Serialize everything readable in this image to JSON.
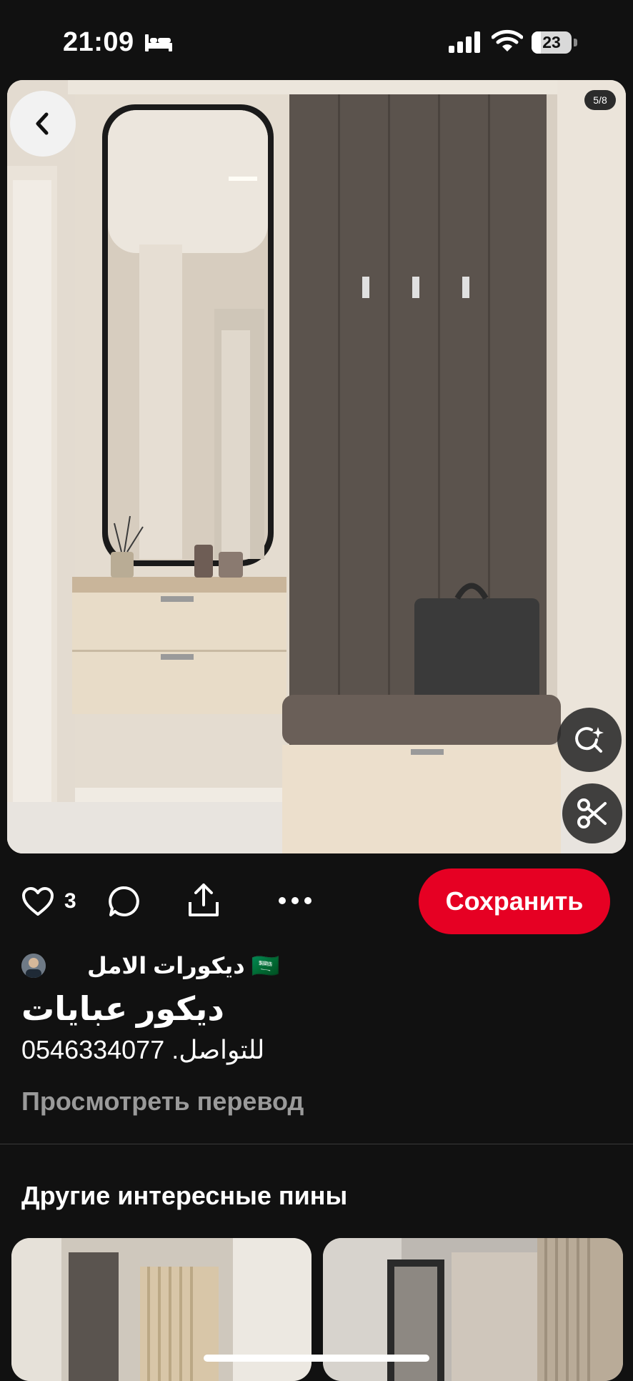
{
  "status_bar": {
    "time": "21:09",
    "battery_level": "23",
    "battery_fraction": 0.23,
    "icons": [
      "bed-icon",
      "cellular-signal-icon",
      "wifi-icon",
      "battery-icon"
    ]
  },
  "pin": {
    "page_counter": "5/8",
    "like_count": "3",
    "save_label": "Сохранить",
    "author_name": "ديكورات الامل 🇸🇦",
    "title": "ديكور عبايات",
    "description": "للتواصل. 0546334077",
    "translate_label": "Просмотреть перевод"
  },
  "more_pins": {
    "heading": "Другие интересные пины"
  },
  "colors": {
    "background": "#111111",
    "save_button": "#e60023",
    "muted_text": "#9a9a9a"
  }
}
